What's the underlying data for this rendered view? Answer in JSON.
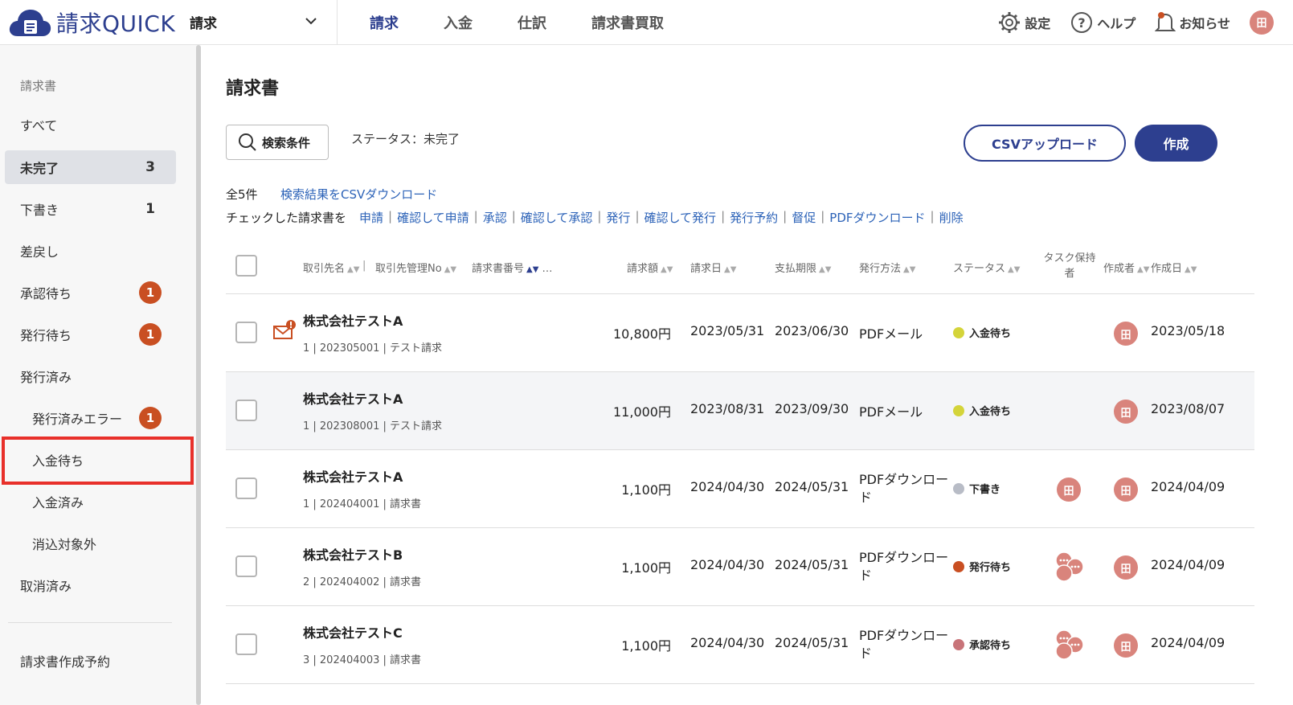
{
  "app": {
    "logo_text_1": "請求",
    "logo_text_2": "QUICK",
    "product_selector": "請求"
  },
  "topnav": {
    "items": [
      "請求",
      "入金",
      "仕訳",
      "請求書買取"
    ]
  },
  "top_right": {
    "settings": "設定",
    "help": "ヘルプ",
    "notifications": "お知らせ",
    "user_initial": "田"
  },
  "sidebar": {
    "heading": "請求書",
    "items": [
      {
        "label": "すべて"
      },
      {
        "label": "未完了",
        "count": "3"
      },
      {
        "label": "下書き",
        "count": "1"
      },
      {
        "label": "差戻し"
      },
      {
        "label": "承認待ち",
        "badge": "1"
      },
      {
        "label": "発行待ち",
        "badge": "1"
      },
      {
        "label": "発行済み"
      },
      {
        "label": "発行済みエラー",
        "badge": "1"
      },
      {
        "label": "入金待ち"
      },
      {
        "label": "入金済み"
      },
      {
        "label": "消込対象外"
      },
      {
        "label": "取消済み"
      },
      {
        "label": "請求書作成予約"
      }
    ]
  },
  "main": {
    "title": "請求書",
    "search_button": "検索条件",
    "status_filter": "ステータス：未完了",
    "csv_upload": "CSVアップロード",
    "create": "作成",
    "total": "全5件",
    "csv_download": "検索結果をCSVダウンロード",
    "bulk_label": "チェックした請求書を",
    "bulk_actions": [
      "申請",
      "確認して申請",
      "承認",
      "確認して承認",
      "発行",
      "確認して発行",
      "発行予約",
      "督促",
      "PDFダウンロード",
      "削除"
    ]
  },
  "table": {
    "headers": {
      "client": "取引先名",
      "client_no": "取引先管理No",
      "invoice_no": "請求書番号",
      "more": "…",
      "amount": "請求額",
      "invoice_date": "請求日",
      "due_date": "支払期限",
      "method": "発行方法",
      "status": "ステータス",
      "task_holder": "タスク保持者",
      "creator": "作成者",
      "created": "作成日"
    },
    "rows": [
      {
        "client": "株式会社テストA",
        "meta": "1 | 202305001 | テスト請求",
        "amount": "10,800円",
        "invoice_date": "2023/05/31",
        "due_date": "2023/06/30",
        "method": "PDFメール",
        "status": "入金待ち",
        "status_color": "#d4d43a",
        "assignee": "",
        "creator": "田",
        "created": "2023/05/18",
        "mail_alert": true
      },
      {
        "client": "株式会社テストA",
        "meta": "1 | 202308001 | テスト請求",
        "amount": "11,000円",
        "invoice_date": "2023/08/31",
        "due_date": "2023/09/30",
        "method": "PDFメール",
        "status": "入金待ち",
        "status_color": "#d4d43a",
        "assignee": "",
        "creator": "田",
        "created": "2023/08/07"
      },
      {
        "client": "株式会社テストA",
        "meta": "1 | 202404001 | 請求書",
        "amount": "1,100円",
        "invoice_date": "2024/04/30",
        "due_date": "2024/05/31",
        "method": "PDFダウンロード",
        "status": "下書き",
        "status_color": "#b8bcc6",
        "assignee": "田",
        "creator": "田",
        "created": "2024/04/09"
      },
      {
        "client": "株式会社テストB",
        "meta": "2 | 202404002 | 請求書",
        "amount": "1,100円",
        "invoice_date": "2024/04/30",
        "due_date": "2024/05/31",
        "method": "PDFダウンロード",
        "status": "発行待ち",
        "status_color": "#c94f22",
        "assignee": "multi",
        "creator": "田",
        "created": "2024/04/09"
      },
      {
        "client": "株式会社テストC",
        "meta": "3 | 202404003 | 請求書",
        "amount": "1,100円",
        "invoice_date": "2024/04/30",
        "due_date": "2024/05/31",
        "method": "PDFダウンロード",
        "status": "承認待ち",
        "status_color": "#c87479",
        "assignee": "multi",
        "creator": "田",
        "created": "2024/04/09"
      }
    ]
  },
  "colors": {
    "brand": "#2d3f8f",
    "link": "#2d63b8",
    "badge": "#c94f22",
    "highlight": "#e8302a",
    "avatar": "#d9847c"
  }
}
